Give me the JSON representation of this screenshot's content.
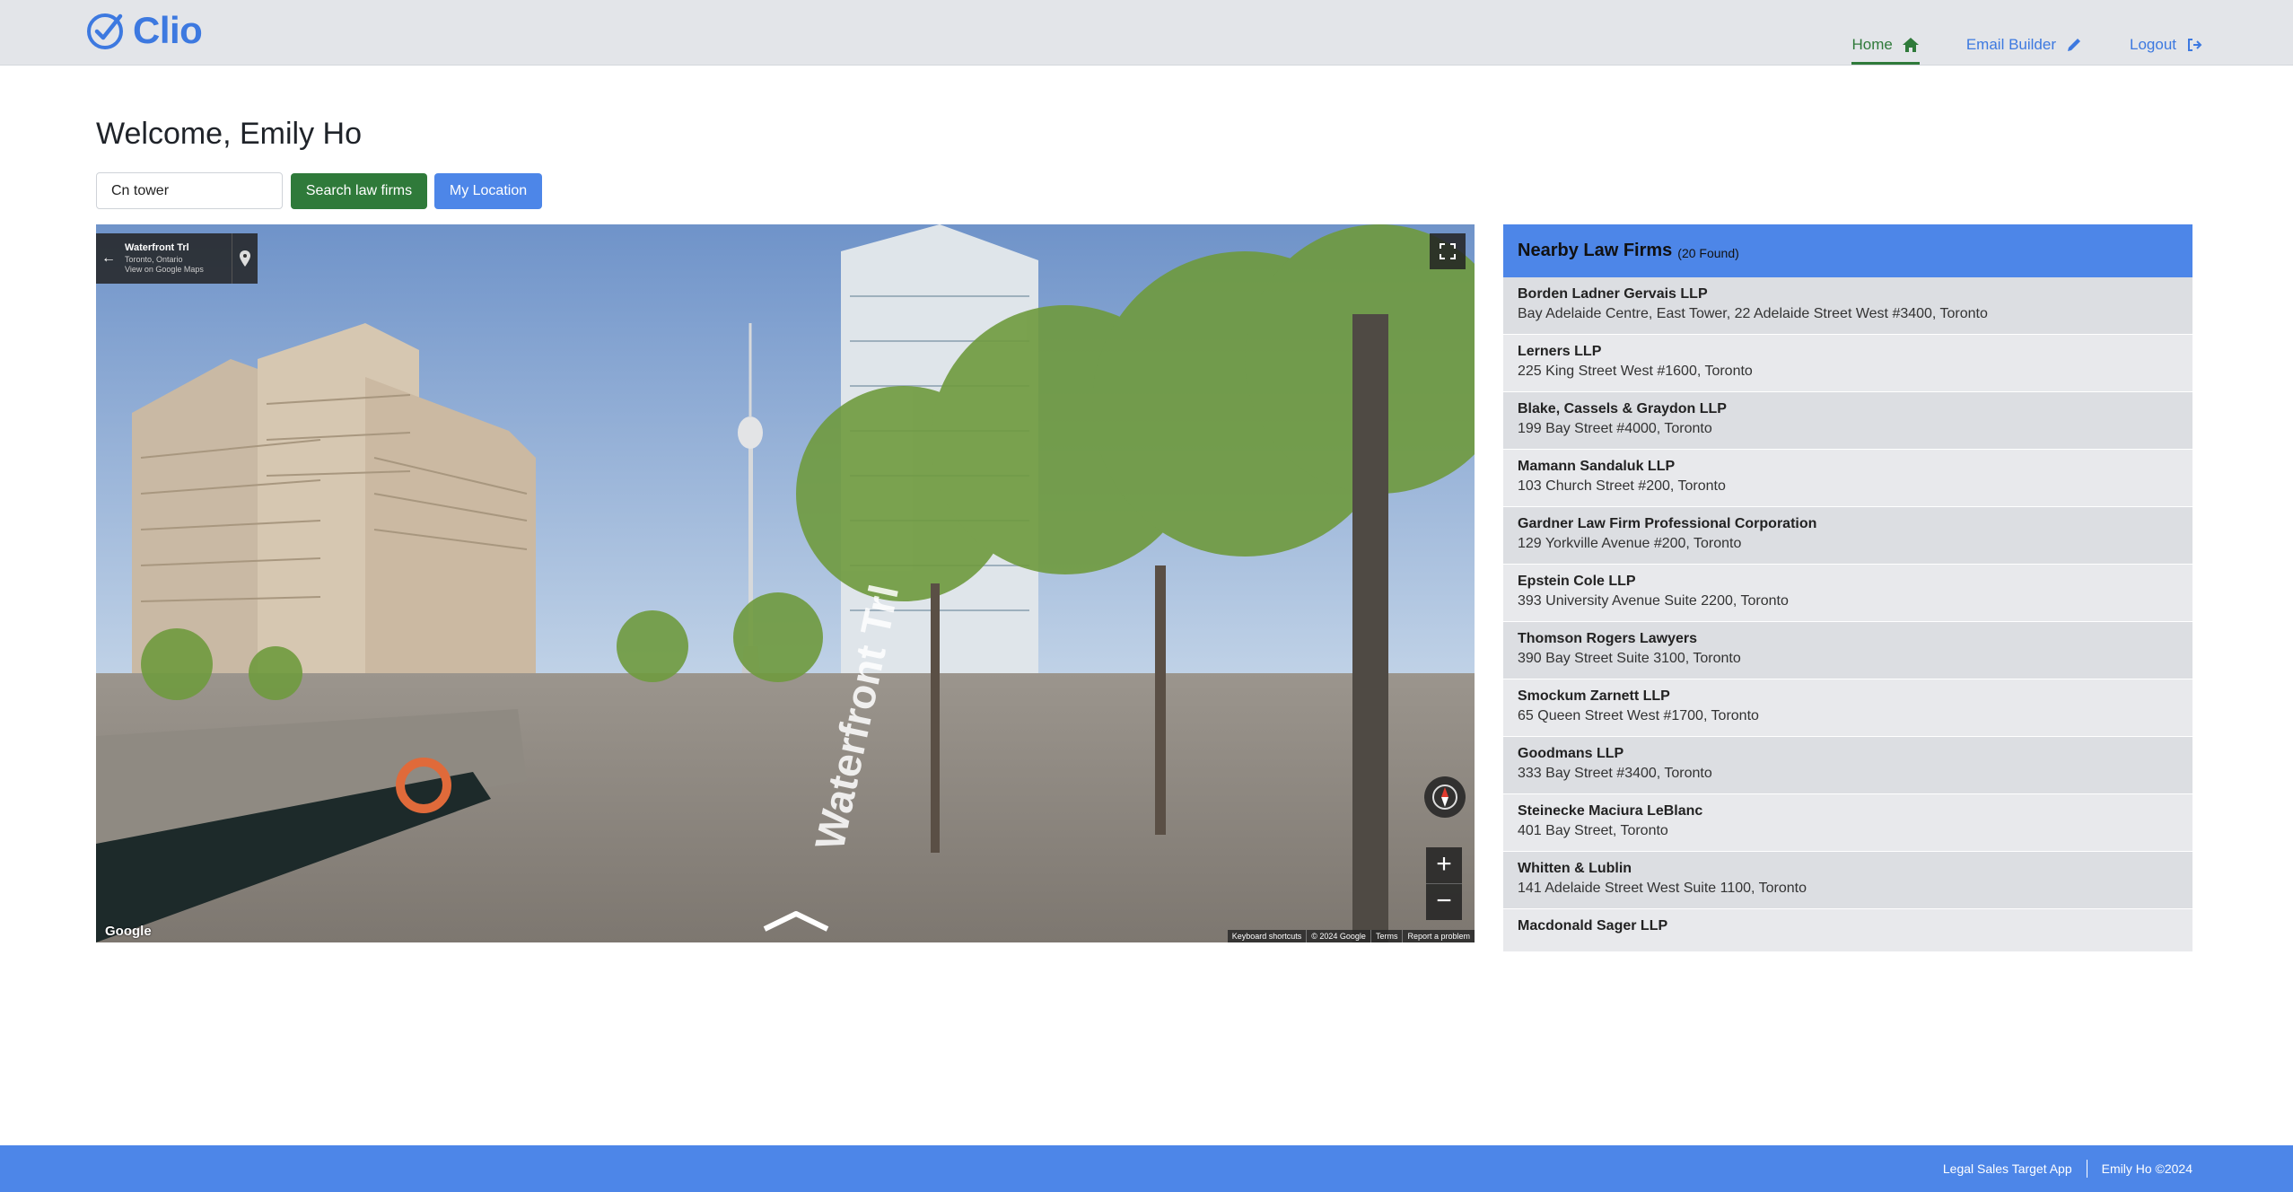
{
  "app": {
    "name": "Clio"
  },
  "nav": [
    {
      "label": "Home",
      "icon": "home-icon",
      "active": true
    },
    {
      "label": "Email Builder",
      "icon": "pencil-icon",
      "active": false
    },
    {
      "label": "Logout",
      "icon": "logout-icon",
      "active": false
    }
  ],
  "page": {
    "title": "Welcome, Emily Ho"
  },
  "search": {
    "value": "Cn tower",
    "search_button": "Search law firms",
    "location_button": "My Location"
  },
  "map": {
    "location_title": "Waterfront Trl",
    "location_subtitle": "Toronto, Ontario",
    "view_link": "View on Google Maps",
    "street_label": "Waterfront Trl",
    "google_logo": "Google",
    "attribution": [
      "Keyboard shortcuts",
      "© 2024 Google",
      "Terms",
      "Report a problem"
    ],
    "zoom_in": "+",
    "zoom_out": "−"
  },
  "firms_panel": {
    "title": "Nearby Law Firms",
    "count_label": "(20 Found)",
    "firms": [
      {
        "name": "Borden Ladner Gervais LLP",
        "address": "Bay Adelaide Centre, East Tower, 22 Adelaide Street West #3400, Toronto"
      },
      {
        "name": "Lerners LLP",
        "address": "225 King Street West #1600, Toronto"
      },
      {
        "name": "Blake, Cassels & Graydon LLP",
        "address": "199 Bay Street #4000, Toronto"
      },
      {
        "name": "Mamann Sandaluk LLP",
        "address": "103 Church Street #200, Toronto"
      },
      {
        "name": "Gardner Law Firm Professional Corporation",
        "address": "129 Yorkville Avenue #200, Toronto"
      },
      {
        "name": "Epstein Cole LLP",
        "address": "393 University Avenue Suite 2200, Toronto"
      },
      {
        "name": "Thomson Rogers Lawyers",
        "address": "390 Bay Street Suite 3100, Toronto"
      },
      {
        "name": "Smockum Zarnett LLP",
        "address": "65 Queen Street West #1700, Toronto"
      },
      {
        "name": "Goodmans LLP",
        "address": "333 Bay Street #3400, Toronto"
      },
      {
        "name": "Steinecke Maciura LeBlanc",
        "address": "401 Bay Street, Toronto"
      },
      {
        "name": "Whitten & Lublin",
        "address": "141 Adelaide Street West Suite 1100, Toronto"
      },
      {
        "name": "Macdonald Sager LLP",
        "address": ""
      }
    ]
  },
  "footer": {
    "app_label": "Legal Sales Target App",
    "copyright": "Emily Ho ©2024"
  },
  "colors": {
    "brand_blue": "#4d86e8",
    "brand_green": "#2f7a3a",
    "header_bg": "#e3e5e9"
  }
}
